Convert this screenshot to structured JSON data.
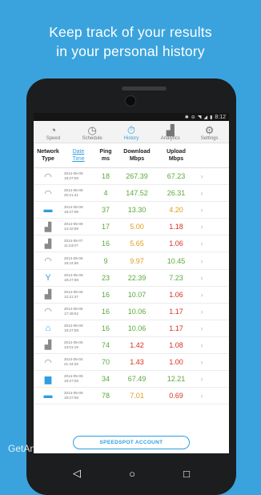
{
  "headline": [
    "Keep track of your results",
    "in your personal history"
  ],
  "status_bar": {
    "time": "8:12"
  },
  "tabs": [
    {
      "label": "Speed",
      "icon": "speedometer-icon",
      "glyph": "◔",
      "active": false
    },
    {
      "label": "Schedule",
      "icon": "clock-icon",
      "glyph": "◷",
      "active": false
    },
    {
      "label": "History",
      "icon": "stopwatch-icon",
      "glyph": "⏱",
      "active": true
    },
    {
      "label": "Analytics",
      "icon": "bar-chart-icon",
      "glyph": "▟",
      "active": false
    },
    {
      "label": "Settings",
      "icon": "gear-icon",
      "glyph": "⚙",
      "active": false
    }
  ],
  "columns": {
    "network": [
      "Network",
      "Type"
    ],
    "date": [
      "Date",
      "Time"
    ],
    "ping": [
      "Ping",
      "ms"
    ],
    "download": [
      "Download",
      "Mbps"
    ],
    "upload": [
      "Upload",
      "Mbps"
    ]
  },
  "colors": {
    "good": "#5aa83b",
    "medium": "#e39a1c",
    "bad": "#d9301c",
    "accent": "#2f9ee0"
  },
  "rows": [
    {
      "net": "wifi-icon",
      "glyph": "◠",
      "date": "2014-05-09",
      "time": "19:27:08",
      "ping": "18",
      "download": "267.39",
      "dl_color": "#5aa83b",
      "upload": "67.23",
      "ul_color": "#5aa83b"
    },
    {
      "net": "wifi-icon",
      "glyph": "◠",
      "date": "2014-05-08",
      "time": "20:21:41",
      "ping": "4",
      "download": "147.52",
      "dl_color": "#5aa83b",
      "upload": "26.31",
      "ul_color": "#5aa83b"
    },
    {
      "net": "bed-icon",
      "glyph": "▬",
      "date": "2014-05-09",
      "time": "19:27:08",
      "ping": "37",
      "download": "13.30",
      "dl_color": "#5aa83b",
      "upload": "4.20",
      "ul_color": "#e39a1c"
    },
    {
      "net": "cell-signal-icon",
      "glyph": "▟",
      "date": "2014-05-08",
      "time": "14:42:59",
      "ping": "17",
      "download": "5.00",
      "dl_color": "#e39a1c",
      "upload": "1.18",
      "ul_color": "#d9301c"
    },
    {
      "net": "cell-signal-icon",
      "glyph": "▟",
      "date": "2014-05-07",
      "time": "11:43:07",
      "ping": "16",
      "download": "5.65",
      "dl_color": "#e39a1c",
      "upload": "1.06",
      "ul_color": "#d9301c"
    },
    {
      "net": "wifi-icon",
      "glyph": "◠",
      "date": "2014-05-06",
      "time": "19:24:56",
      "ping": "9",
      "download": "9.97",
      "dl_color": "#e39a1c",
      "upload": "10.45",
      "ul_color": "#5aa83b"
    },
    {
      "net": "cocktail-icon",
      "glyph": "Y",
      "date": "2014-05-09",
      "time": "19:27:08",
      "ping": "23",
      "download": "22.39",
      "dl_color": "#5aa83b",
      "upload": "7.23",
      "ul_color": "#5aa83b"
    },
    {
      "net": "cell-signal-icon",
      "glyph": "▟",
      "date": "2014-05-05",
      "time": "12:21:37",
      "ping": "16",
      "download": "10.07",
      "dl_color": "#5aa83b",
      "upload": "1.06",
      "ul_color": "#d9301c"
    },
    {
      "net": "wifi-icon",
      "glyph": "◠",
      "date": "2014-05-05",
      "time": "17:49:02",
      "ping": "16",
      "download": "10.06",
      "dl_color": "#5aa83b",
      "upload": "1.17",
      "ul_color": "#d9301c"
    },
    {
      "net": "home-icon",
      "glyph": "⌂",
      "date": "2014-05-09",
      "time": "19:27:08",
      "ping": "16",
      "download": "10.06",
      "dl_color": "#5aa83b",
      "upload": "1.17",
      "ul_color": "#d9301c"
    },
    {
      "net": "cell-signal-icon",
      "glyph": "▟",
      "date": "2014-05-05",
      "time": "13:01:19",
      "ping": "74",
      "download": "1.42",
      "dl_color": "#d9301c",
      "upload": "1.08",
      "ul_color": "#d9301c"
    },
    {
      "net": "wifi-icon",
      "glyph": "◠",
      "date": "2014-05-04",
      "time": "21:44:26",
      "ping": "70",
      "download": "1.43",
      "dl_color": "#d9301c",
      "upload": "1.00",
      "ul_color": "#d9301c"
    },
    {
      "net": "coffee-icon",
      "glyph": "▆",
      "date": "2014-05-09",
      "time": "19:27:08",
      "ping": "34",
      "download": "67.49",
      "dl_color": "#5aa83b",
      "upload": "12.21",
      "ul_color": "#5aa83b"
    },
    {
      "net": "bed-icon",
      "glyph": "▬",
      "date": "2014-05-09",
      "time": "19:27:08",
      "ping": "78",
      "download": "7.01",
      "dl_color": "#e39a1c",
      "upload": "0.69",
      "ul_color": "#d9301c"
    }
  ],
  "account_button": "SPEEDSPOT ACCOUNT",
  "watermark": "GetAndroid.iR"
}
